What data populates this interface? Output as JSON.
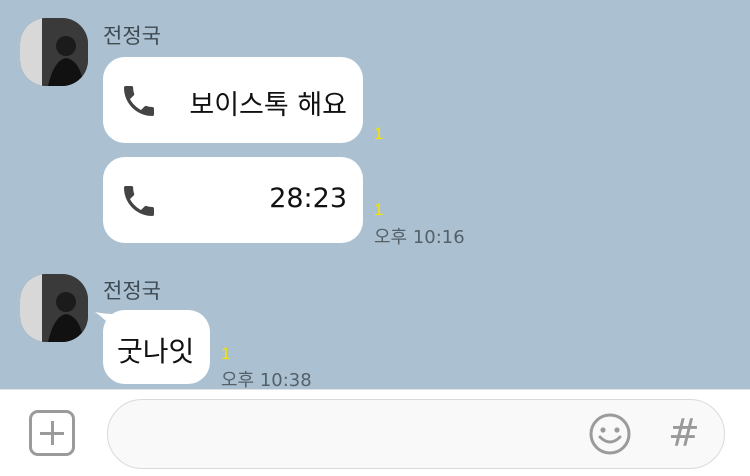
{
  "conversation": {
    "groups": [
      {
        "sender": "전정국",
        "messages": [
          {
            "icon": "phone-icon",
            "text": "보이스톡 해요",
            "read_count": "1"
          },
          {
            "icon": "phone-icon",
            "text": "28:23",
            "read_count": "1",
            "time": "오후 10:16"
          }
        ]
      },
      {
        "sender": "전정국",
        "messages": [
          {
            "text": "굿나잇",
            "read_count": "1",
            "time": "오후 10:38"
          }
        ]
      }
    ]
  },
  "input_bar": {
    "add_icon": "plus-square-icon",
    "emoji_icon": "smiley-icon",
    "hashtag_label": "#"
  },
  "colors": {
    "chat_background": "#abc1d1",
    "bubble": "#ffffff",
    "read_count": "#f7e200"
  }
}
